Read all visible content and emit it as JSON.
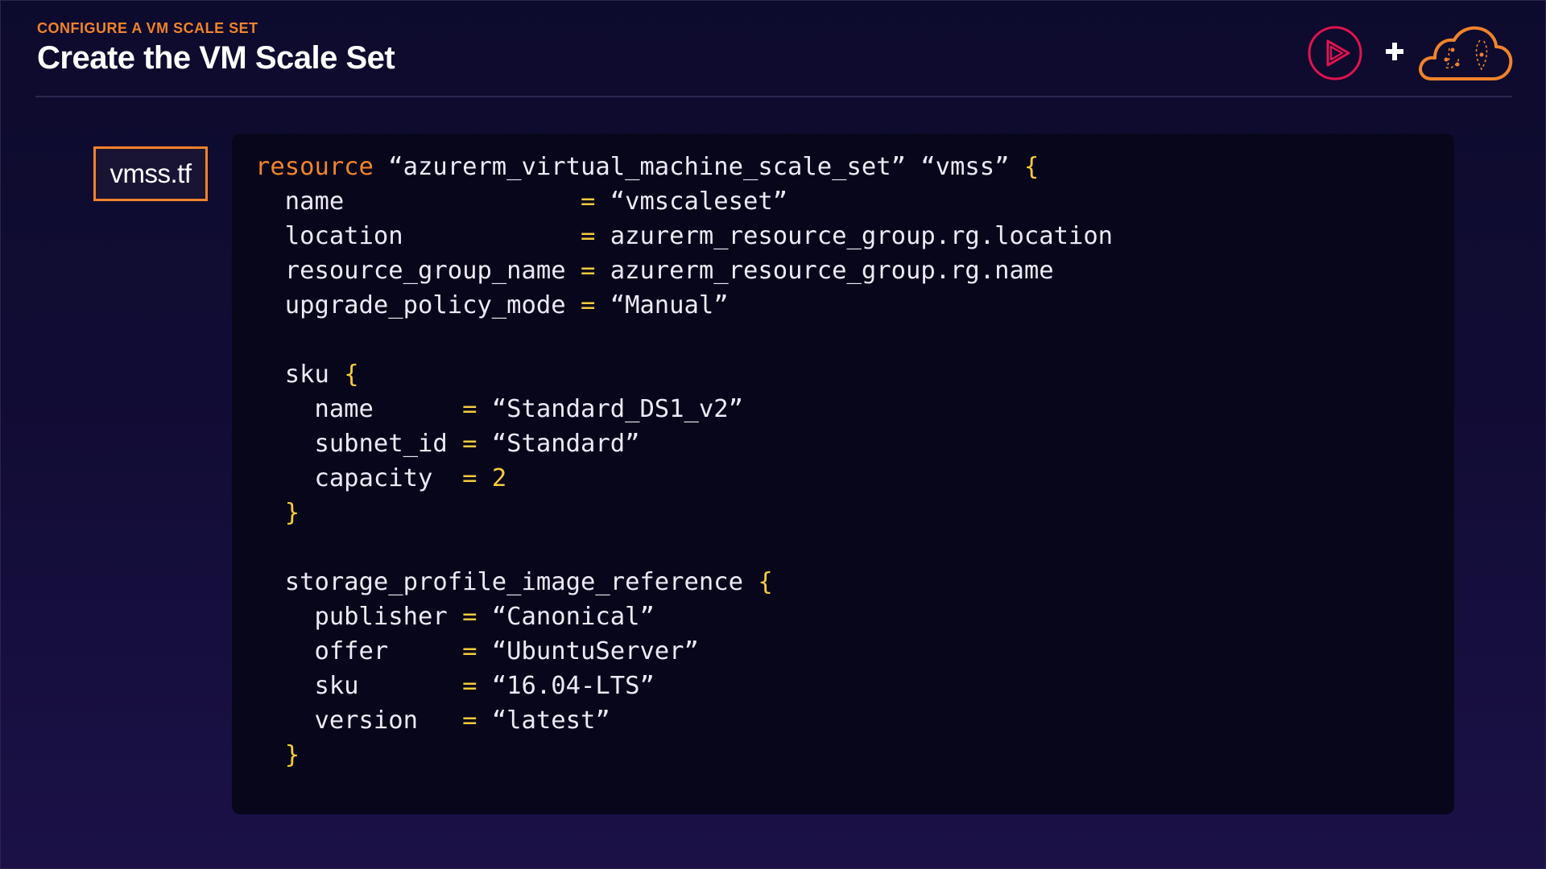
{
  "header": {
    "section_label": "CONFIGURE A VM SCALE SET",
    "title": "Create the VM Scale Set",
    "plus_symbol": "+"
  },
  "logos": [
    {
      "name": "pluralsight-play-icon",
      "color": "#e0134f"
    },
    {
      "name": "cloud-icon",
      "color": "#f0832c"
    }
  ],
  "colors": {
    "accent_orange": "#f0832c",
    "operator_yellow": "#f5cc3a",
    "code_text": "#eceaf5",
    "code_background": "#08061a"
  },
  "file_tab": {
    "label": "vmss.tf"
  },
  "code": {
    "l01": {
      "keyword": "resource",
      "text": " “azurerm_virtual_machine_scale_set” “vmss” ",
      "open": "{"
    },
    "l02": {
      "key": "  name                ",
      "op": "=",
      "value": " “vmscaleset”"
    },
    "l03": {
      "key": "  location            ",
      "op": "=",
      "value": " azurerm_resource_group.rg.location"
    },
    "l04": {
      "key": "  resource_group_name ",
      "op": "=",
      "value": " azurerm_resource_group.rg.name"
    },
    "l05": {
      "key": "  upgrade_policy_mode ",
      "op": "=",
      "value": " “Manual”"
    },
    "l06": {
      "text": ""
    },
    "l07": {
      "key": "  sku ",
      "open": "{"
    },
    "l08": {
      "key": "    name      ",
      "op": "=",
      "value": " “Standard_DS1_v2”"
    },
    "l09": {
      "key": "    subnet_id ",
      "op": "=",
      "value": " “Standard”"
    },
    "l10": {
      "key": "    capacity  ",
      "op": "=",
      "number": " 2"
    },
    "l11": {
      "indent": "  ",
      "close": "}"
    },
    "l12": {
      "text": ""
    },
    "l13": {
      "key": "  storage_profile_image_reference ",
      "open": "{"
    },
    "l14": {
      "key": "    publisher ",
      "op": "=",
      "value": " “Canonical”"
    },
    "l15": {
      "key": "    offer     ",
      "op": "=",
      "value": " “UbuntuServer”"
    },
    "l16": {
      "key": "    sku       ",
      "op": "=",
      "value": " “16.04-LTS”"
    },
    "l17": {
      "key": "    version   ",
      "op": "=",
      "value": " “latest”"
    },
    "l18": {
      "indent": "  ",
      "close": "}"
    }
  }
}
